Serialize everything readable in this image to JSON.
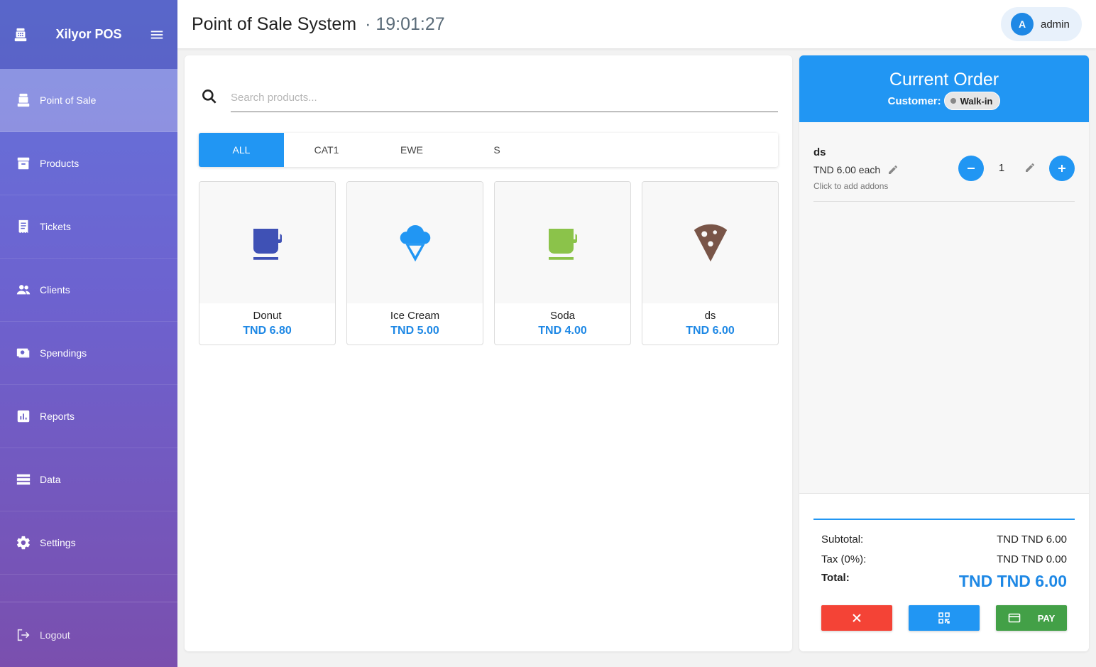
{
  "sidebar": {
    "brand": "Xilyor POS",
    "items": [
      {
        "label": "Point of Sale",
        "icon": "cash-register-icon",
        "active": true
      },
      {
        "label": "Products",
        "icon": "archive-box-icon"
      },
      {
        "label": "Tickets",
        "icon": "receipt-icon"
      },
      {
        "label": "Clients",
        "icon": "people-icon"
      },
      {
        "label": "Spendings",
        "icon": "money-icon"
      },
      {
        "label": "Reports",
        "icon": "bar-chart-icon"
      },
      {
        "label": "Data",
        "icon": "storage-icon"
      },
      {
        "label": "Settings",
        "icon": "gear-icon"
      }
    ],
    "logout_label": "Logout"
  },
  "header": {
    "title": "Point of Sale System",
    "clock": "· 19:01:27",
    "user_initial": "A",
    "user_name": "admin"
  },
  "search": {
    "placeholder": "Search products..."
  },
  "categories": [
    "ALL",
    "CAT1",
    "EWE",
    "S"
  ],
  "products": [
    {
      "name": "Donut",
      "price": "TND 6.80",
      "icon": "coffee-cup-icon",
      "color": "#3f51b5"
    },
    {
      "name": "Ice Cream",
      "price": "TND 5.00",
      "icon": "ice-cream-icon",
      "color": "#2196f3"
    },
    {
      "name": "Soda",
      "price": "TND 4.00",
      "icon": "coffee-cup-icon",
      "color": "#8bc34a"
    },
    {
      "name": "ds",
      "price": "TND 6.00",
      "icon": "pizza-slice-icon",
      "color": "#795548"
    }
  ],
  "order": {
    "title": "Current Order",
    "customer_label": "Customer:",
    "customer": "Walk-in",
    "items": [
      {
        "name": "ds",
        "each": "TND 6.00 each",
        "addons_hint": "Click to add addons",
        "qty": "1"
      }
    ],
    "subtotal_label": "Subtotal:",
    "subtotal": "TND TND 6.00",
    "tax_label": "Tax (0%):",
    "tax": "TND TND 0.00",
    "total_label": "Total:",
    "total": "TND TND 6.00",
    "pay_label": "PAY"
  },
  "colors": {
    "accent": "#2196f3",
    "cancel": "#f44336",
    "pay": "#43a047"
  }
}
